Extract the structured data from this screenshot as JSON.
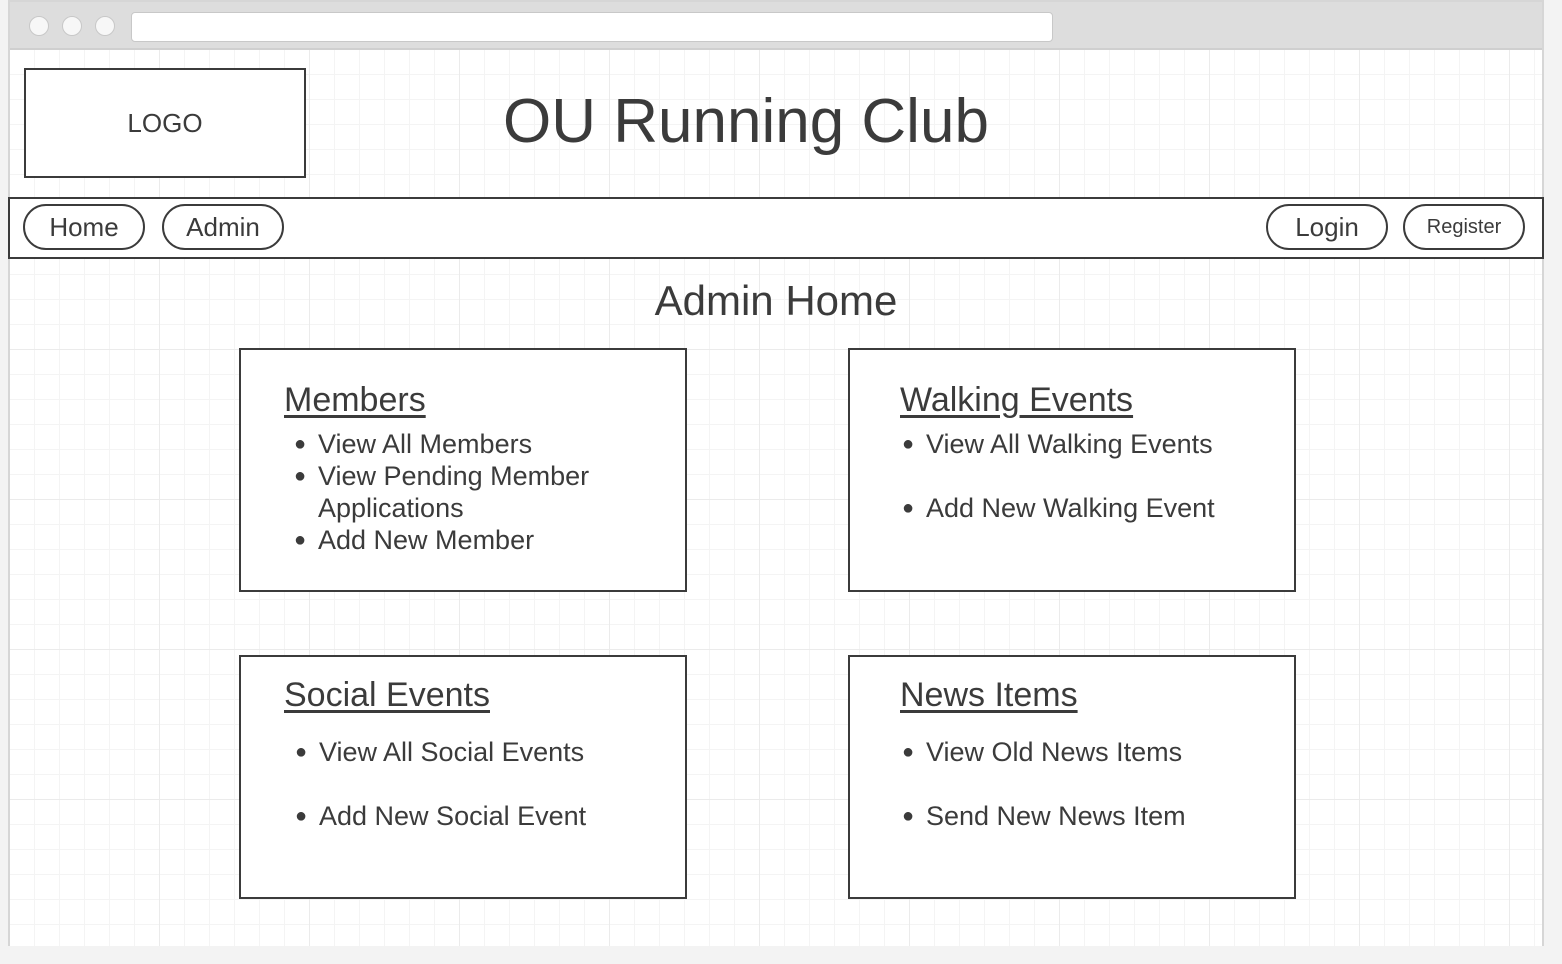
{
  "browser": {
    "controls": [
      "close-dot",
      "minimize-dot",
      "maximize-dot"
    ],
    "url": ""
  },
  "header": {
    "logo_text": "LOGO",
    "site_title": "OU Running Club"
  },
  "nav": {
    "left": [
      {
        "label": "Home"
      },
      {
        "label": "Admin"
      }
    ],
    "right": [
      {
        "label": "Login"
      },
      {
        "label": "Register"
      }
    ]
  },
  "page_title": "Admin Home",
  "cards": [
    {
      "title": "Members",
      "items": [
        "View All Members",
        "View Pending Member Applications",
        "Add New Member"
      ]
    },
    {
      "title": "Walking Events",
      "items": [
        "View All Walking Events",
        "Add New Walking Event"
      ]
    },
    {
      "title": "Social Events",
      "items": [
        "View All Social Events",
        "Add New Social Event"
      ]
    },
    {
      "title": "News Items",
      "items": [
        "View Old News Items",
        "Send New News Item"
      ]
    }
  ],
  "bullet_glyph": "●",
  "colors": {
    "ink": "#3b3b3b",
    "grid": "#ebebeb",
    "chrome": "#dddddd"
  }
}
